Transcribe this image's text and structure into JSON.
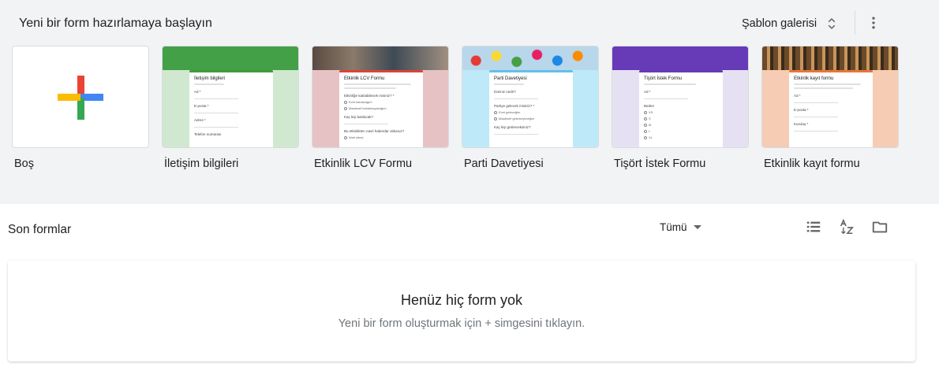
{
  "start": {
    "title": "Yeni bir form hazırlamaya başlayın",
    "gallery_label": "Şablon galerisi"
  },
  "templates": [
    {
      "label": "Boş",
      "accent": "#ffffff"
    },
    {
      "label": "İletişim bilgileri",
      "accent": "#3e9d3a",
      "card_title": "İletişim bilgileri",
      "q1": "Ad *",
      "q2": "E-posta *",
      "q3": "Adres *",
      "q4": "Telefon numarası"
    },
    {
      "label": "Etkinlik LCV Formu",
      "accent": "#db4437",
      "card_title": "Etkinlik LCV Formu",
      "q1": "Etkinliğe katılabilecek misiniz? *",
      "o1": "Evet katılacağım",
      "o2": "Maalesef katılamayacağım",
      "q2": "Kaç kişi katılacak?",
      "q3": "Bu etkinlikten nasıl haberdar oldunuz?",
      "o3": "Web sitesi"
    },
    {
      "label": "Parti Davetiyesi",
      "accent": "#62c0ec",
      "card_title": "Parti Davetiyesi",
      "q1": "İsminiz nedir?",
      "q2": "Partiye gelecek misiniz? *",
      "o1": "Evet geleceğim",
      "o2": "Maalesef gelemeyeceğim",
      "q3": "Kaç kişi getireceksiniz?"
    },
    {
      "label": "Tişört İstek Formu",
      "accent": "#673ab7",
      "card_title": "Tişört İstek Formu",
      "q1": "Ad *",
      "q2": "Beden",
      "sizes": [
        "XS",
        "S",
        "M",
        "L",
        "XL"
      ]
    },
    {
      "label": "Etkinlik kayıt formu",
      "accent": "#e8763a",
      "card_title": "Etkinlik kayıt formu",
      "q1": "Ad *",
      "q2": "E-posta *",
      "q3": "Kuruluş *"
    }
  ],
  "recent": {
    "title": "Son formlar",
    "filter_label": "Tümü",
    "empty_title": "Henüz hiç form yok",
    "empty_subtitle": "Yeni bir form oluşturmak için + simgesini tıklayın."
  },
  "icons": {
    "gallery": "unfold-icon",
    "more": "more-vert-icon",
    "list_view": "list-view-icon",
    "sort": "sort-az-icon",
    "folder": "folder-icon"
  }
}
